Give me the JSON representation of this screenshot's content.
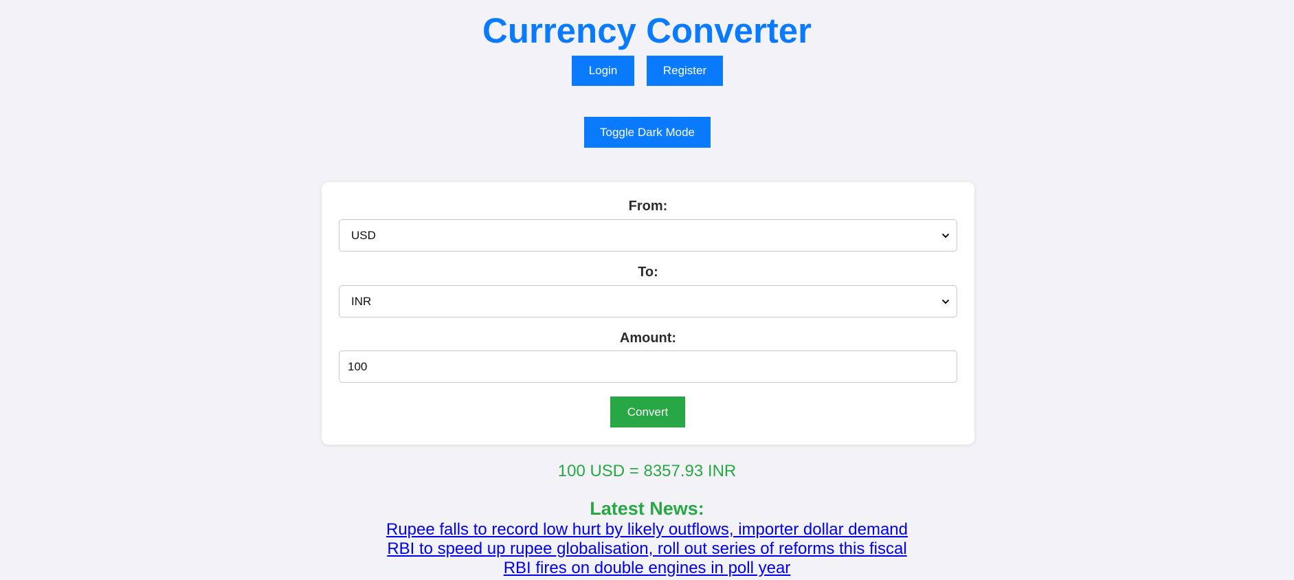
{
  "header": {
    "title": "Currency Converter",
    "login_label": "Login",
    "register_label": "Register",
    "dark_mode_label": "Toggle Dark Mode"
  },
  "form": {
    "from_label": "From:",
    "from_value": "USD",
    "to_label": "To:",
    "to_value": "INR",
    "amount_label": "Amount:",
    "amount_value": "100",
    "convert_label": "Convert"
  },
  "result": {
    "text": "100 USD = 8357.93 INR"
  },
  "news": {
    "title": "Latest News:",
    "items": [
      "Rupee falls to record low hurt by likely outflows, importer dollar demand",
      "RBI to speed up rupee globalisation, roll out series of reforms this fiscal",
      "RBI fires on double engines in poll year"
    ]
  },
  "colors": {
    "primary": "#0a7bff",
    "success": "#28a745",
    "link": "#0000ee",
    "background": "#f3f3f7"
  },
  "icons": {
    "select_arrow": "chevron-down-icon"
  }
}
